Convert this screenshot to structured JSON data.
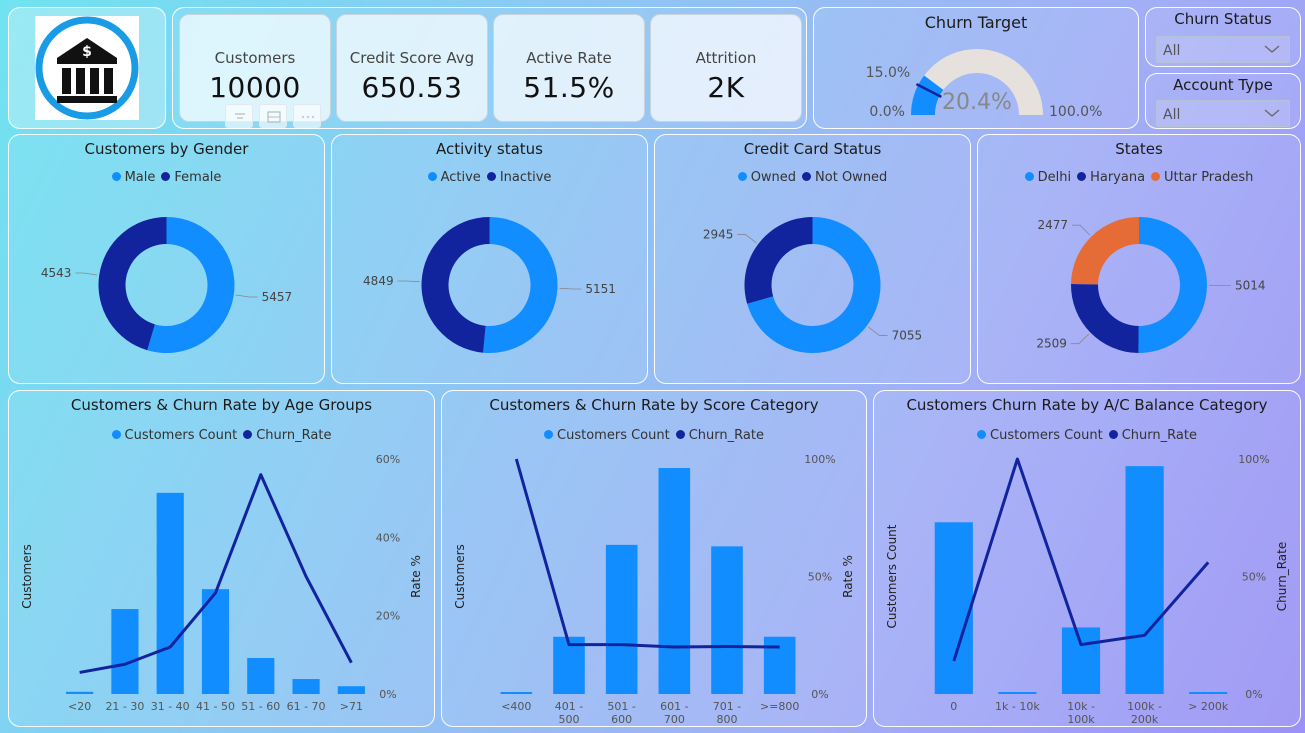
{
  "kpis": [
    {
      "label": "Customers",
      "value": "10000"
    },
    {
      "label": "Credit Score Avg",
      "value": "650.53"
    },
    {
      "label": "Active Rate",
      "value": "51.5%"
    },
    {
      "label": "Attrition",
      "value": "2K"
    }
  ],
  "churn_target": {
    "title": "Churn Target",
    "min_label": "0.0%",
    "max_label": "100.0%",
    "target_label": "15.0%",
    "value_label": "20.4%",
    "value": 20.4,
    "target": 15.0,
    "colors": {
      "fill": "#118dff",
      "track": "#e6e1dc",
      "target": "#12239e"
    }
  },
  "slicers": {
    "churn_status": {
      "title": "Churn Status",
      "value": "All"
    },
    "account_type": {
      "title": "Account Type",
      "value": "All"
    }
  },
  "colors": {
    "primary": "#118dff",
    "secondary": "#12239e",
    "orange": "#e66c37"
  },
  "chart_data": [
    {
      "type": "pie",
      "title": "Customers by Gender",
      "legend": [
        {
          "name": "Male",
          "color": "#118dff"
        },
        {
          "name": "Female",
          "color": "#12239e"
        }
      ],
      "values": [
        5457,
        4543
      ],
      "labels": [
        "5457",
        "4543"
      ],
      "donut": true
    },
    {
      "type": "pie",
      "title": "Activity status",
      "legend": [
        {
          "name": "Active",
          "color": "#118dff"
        },
        {
          "name": "Inactive",
          "color": "#12239e"
        }
      ],
      "values": [
        5151,
        4849
      ],
      "labels": [
        "5151",
        "4849"
      ],
      "donut": true
    },
    {
      "type": "pie",
      "title": "Credit Card Status",
      "legend": [
        {
          "name": "Owned",
          "color": "#118dff"
        },
        {
          "name": "Not Owned",
          "color": "#12239e"
        }
      ],
      "values": [
        7055,
        2945
      ],
      "labels": [
        "7055",
        "2945"
      ],
      "donut": true
    },
    {
      "type": "pie",
      "title": "States",
      "legend": [
        {
          "name": "Delhi",
          "color": "#118dff"
        },
        {
          "name": "Haryana",
          "color": "#12239e"
        },
        {
          "name": "Uttar Pradesh",
          "color": "#e66c37"
        }
      ],
      "values": [
        5014,
        2509,
        2477
      ],
      "labels": [
        "5014",
        "2509",
        "2477"
      ],
      "donut": true
    },
    {
      "type": "bar",
      "title": "Customers & Churn Rate by Age Groups",
      "legend": [
        {
          "name": "Customers Count",
          "color": "#118dff"
        },
        {
          "name": "Churn_Rate",
          "color": "#12239e"
        }
      ],
      "categories": [
        [
          "<20"
        ],
        [
          "21 - 30"
        ],
        [
          "31 - 40"
        ],
        [
          "41 - 50"
        ],
        [
          "51 - 60"
        ],
        [
          "61 - 70"
        ],
        [
          ">71"
        ]
      ],
      "bars": [
        49,
        1880,
        4451,
        2320,
        797,
        331,
        172
      ],
      "line": [
        5.5,
        7.6,
        12,
        25.8,
        56,
        30,
        8
      ],
      "ylabel": "Customers",
      "y2label": "Rate %",
      "y2ticks": [
        "0%",
        "20%",
        "40%",
        "60%"
      ],
      "y2max": 60,
      "barmax": 5200
    },
    {
      "type": "bar",
      "title": "Customers & Churn Rate by Score Category",
      "legend": [
        {
          "name": "Customers Count",
          "color": "#118dff"
        },
        {
          "name": "Churn_Rate",
          "color": "#12239e"
        }
      ],
      "categories": [
        [
          "<400"
        ],
        [
          "401 -",
          "500"
        ],
        [
          "501 -",
          "600"
        ],
        [
          "601 -",
          "700"
        ],
        [
          "701 -",
          "800"
        ],
        [
          ">=800"
        ]
      ],
      "bars": [
        19,
        760,
        1980,
        3000,
        1960,
        760
      ],
      "line": [
        100,
        21,
        21,
        20,
        20.2,
        20
      ],
      "ylabel": "Customers",
      "y2label": "Rate %",
      "y2ticks": [
        "0%",
        "50%",
        "100%"
      ],
      "y2max": 100,
      "barmax": 3120
    },
    {
      "type": "bar",
      "title": "Customers Churn Rate by A/C Balance Category",
      "legend": [
        {
          "name": "Customers Count",
          "color": "#118dff"
        },
        {
          "name": "Churn_Rate",
          "color": "#12239e"
        }
      ],
      "categories": [
        [
          "0"
        ],
        [
          "1k - 10k"
        ],
        [
          "10k -",
          "100k"
        ],
        [
          "100k -",
          "200k"
        ],
        [
          "> 200k"
        ]
      ],
      "bars": [
        3617,
        2,
        1402,
        4799,
        2
      ],
      "line": [
        14,
        100,
        21,
        25,
        56
      ],
      "ylabel": "Customers Count",
      "y2label": "Churn_Rate",
      "y2ticks": [
        "0%",
        "50%",
        "100%"
      ],
      "y2max": 100,
      "barmax": 4950
    }
  ]
}
